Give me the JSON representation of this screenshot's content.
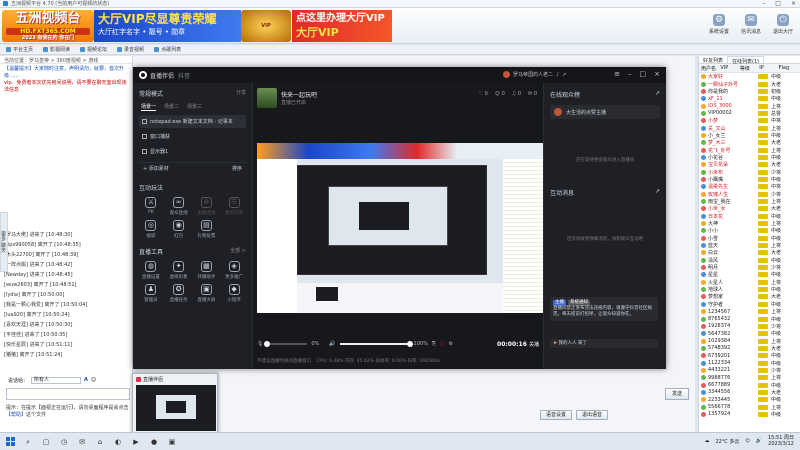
{
  "main": {
    "title": "五洲视频平台 4.70 (当前用户可视频的状态)",
    "logo": {
      "text": "五洲视频台",
      "url": "HD.FXT365.COM",
      "slogan": "2023 有我在的 你在门"
    },
    "ads": {
      "vip_title": "大厅VIP尽显尊贵荣耀",
      "vip_sub": "大厅红字名字 • 靓号 • 勋章",
      "badge": "VIP",
      "vip2_title": "点这里办理大厅VIP",
      "vip2_sub": "大厅VIP"
    },
    "tools": [
      {
        "label": "系统设置",
        "icon": "⚙"
      },
      {
        "label": "信讯消息",
        "icon": "✉"
      },
      {
        "label": "退出大厅",
        "icon": "⏻"
      }
    ],
    "tabs": [
      "平台主页",
      "影视阅读",
      "视频论坛",
      "录音视频",
      "点歌列表"
    ],
    "path": "当前位置：罗马皇帝 > 360度视频 > 游戏",
    "sys_msg_1": "【温馨提示】大家随时注意，声明请勿，就要，首次升级……",
    "sys_msg_2": "vip、免费者本次优先房间说明，请不要在聊天室出现违法信息",
    "joins": [
      "[罗马大佬] 进来了 [10:48:30]",
      "[tips990058] 离开了 [10:48:35]",
      "[木头22700] 离开了 [10:48:39]",
      "[一样点缀] 进来了 [10:48:42]",
      "[Newday] 进来了 [10:48:45]",
      "[wuw2603] 离开了 [10:48:51]",
      "[lydia] 离开了 [10:50:00]",
      "[我是一颗心我爱] 离开了 [10:50:04]",
      "[lua920] 离开了 [10:50:24]",
      "[喜欢天涯] 进来了 [10:50:30]",
      "[平佳佳] 进来了 [10:50:35]",
      "[快乐星辰] 进来了 [10:51:11]",
      "[猪猪] 离开了 [10:51:24]"
    ],
    "chat_label": "说话给：",
    "chat_target": "所有人",
    "send_label": "发送",
    "hint": "提示：在提示【面视正在运行】，请勿桌面程序是会点击",
    "hint_link": "【帮助】",
    "hint_tail": "这个文件",
    "side_vert": "更多 聊天",
    "btn_settings": "语音设置",
    "btn_exit": "退出语音"
  },
  "userlist": {
    "tabs": [
      "好友列表",
      "在线列表(1)"
    ],
    "headers": [
      "用户名",
      "VIP",
      "等级",
      "IP",
      "Flag"
    ],
    "users": [
      [
        "大家好",
        "中级"
      ],
      [
        "一颗仙子外号",
        "大老"
      ],
      [
        "你是我的",
        "初级"
      ],
      [
        "xF_11",
        "中级"
      ],
      [
        "iOS_3000",
        "上将"
      ],
      [
        "VIP00002",
        "总督"
      ],
      [
        "小梦",
        "中将"
      ],
      [
        "关_文山",
        "上将"
      ],
      [
        "小_女兰",
        "中级"
      ],
      [
        "梦_木三",
        "大老"
      ],
      [
        "花飞_外号",
        "上将"
      ],
      [
        "小花谷",
        "中级"
      ],
      [
        "宝贝花朵",
        "大老"
      ],
      [
        "小米布",
        "少将"
      ],
      [
        "小鹰嘴",
        "中级"
      ],
      [
        "温柔先生",
        "中将"
      ],
      [
        "玫瑰人生",
        "少将"
      ],
      [
        "雨宝_我在",
        "上将"
      ],
      [
        "小米_女",
        "大老"
      ],
      [
        "日本花",
        "中级"
      ],
      [
        "大神",
        "上将"
      ],
      [
        "小小",
        "中级"
      ],
      [
        "小雪",
        "中级"
      ],
      [
        "蓝天",
        "上将"
      ],
      [
        "白云",
        "大老"
      ],
      [
        "清风",
        "中级"
      ],
      [
        "明月",
        "少将"
      ],
      [
        "星星",
        "中级"
      ],
      [
        "火星人",
        "上将"
      ],
      [
        "地球人",
        "中级"
      ],
      [
        "梦想家",
        "大老"
      ],
      [
        "守护者",
        "中级"
      ],
      [
        "1234567",
        "上将"
      ],
      [
        "8765432",
        "中级"
      ],
      [
        "1928374",
        "少将"
      ],
      [
        "5647382",
        "中级"
      ],
      [
        "1029384",
        "上将"
      ],
      [
        "5748392",
        "大老"
      ],
      [
        "6739201",
        "中级"
      ],
      [
        "1122334",
        "中级"
      ],
      [
        "4433221",
        "少将"
      ],
      [
        "9988776",
        "上将"
      ],
      [
        "6677889",
        "中级"
      ],
      [
        "3344556",
        "大老"
      ],
      [
        "2233445",
        "中级"
      ],
      [
        "5566778",
        "上将"
      ],
      [
        "1357924",
        "中级"
      ]
    ]
  },
  "live": {
    "app_name": "直播伴侣",
    "app_sub": "抖音",
    "user_name": "罗马帝国的人老二",
    "scene_header": "常规模式",
    "scene_action": "分享",
    "scene_tabs": [
      "场景一",
      "场景二",
      "场景三"
    ],
    "sources": [
      "notepad.exe 新建文本文档 - 记事本",
      "窗口捕获",
      "显示器1"
    ],
    "add_source": "+ 添加素材",
    "add_source_right": "排序",
    "interact_title": "互动玩法",
    "interact_icons": [
      {
        "label": "PK",
        "icon": "⚔",
        "dim": false
      },
      {
        "label": "观众连线",
        "icon": "∞",
        "dim": false
      },
      {
        "label": "主播连线",
        "icon": "⊗",
        "dim": true
      },
      {
        "label": "我的订单",
        "icon": "☰",
        "dim": true
      },
      {
        "label": "福袋",
        "icon": "◎",
        "dim": false
      },
      {
        "label": "红包",
        "icon": "◉",
        "dim": false
      },
      {
        "label": "礼物投票",
        "icon": "▤",
        "dim": false
      }
    ],
    "tools_title": "直播工具",
    "tools_more": "全部 >",
    "tools_icons": [
      {
        "label": "直播设置",
        "icon": "◍"
      },
      {
        "label": "虚拟形象",
        "icon": "✦"
      },
      {
        "label": "开播助手",
        "icon": "▦"
      },
      {
        "label": "更多推广",
        "icon": "◈"
      },
      {
        "label": "管理员",
        "icon": "♟"
      },
      {
        "label": "直播任务",
        "icon": "✪"
      },
      {
        "label": "直播大屏",
        "icon": "▣"
      },
      {
        "label": "小程序",
        "icon": "◆"
      }
    ],
    "stream_name": "快来一起玩吧",
    "stream_sub": "直播已开启",
    "stats": [
      "0",
      "0",
      "0",
      "0"
    ],
    "volume_mic": "0%",
    "volume_speaker": "100%",
    "volume_mic_fraction": 0,
    "volume_speaker_fraction": 1,
    "timer": "00:00:16",
    "stop_label": "关播",
    "status": "CPU: 6.48%  内存: 45.62%  丢帧率: 0.00%  码率: 1665Kb/s",
    "status_warn": "不建议直播时关闭直播窗口",
    "right_audience_title": "在线观众榜",
    "right_audience_card": "大生活的点赞主播",
    "right_audience_empty": "还在等待更多观众进入直播间",
    "right_msg_title": "互动消息",
    "right_msg_empty": "还没有收到弹幕消息，快和观众互动吧",
    "msg_tag": "主播",
    "msg_tag2": "系统通知",
    "msg_text": "直播间禁止发布违法违规内容，请遵守抖音社区规范，每天提前打招呼，让观众知道你在。",
    "msg_join": "我的人人 来了"
  },
  "thumb": {
    "title": "直播伴侣"
  },
  "taskbar": {
    "temp": "22°C 多云",
    "time": "15:51 周日",
    "date": "2023/3/12",
    "icons": [
      "⌕",
      "▢",
      "◷",
      "✉",
      "⌂",
      "◐",
      "▶",
      "●",
      "▣"
    ]
  }
}
